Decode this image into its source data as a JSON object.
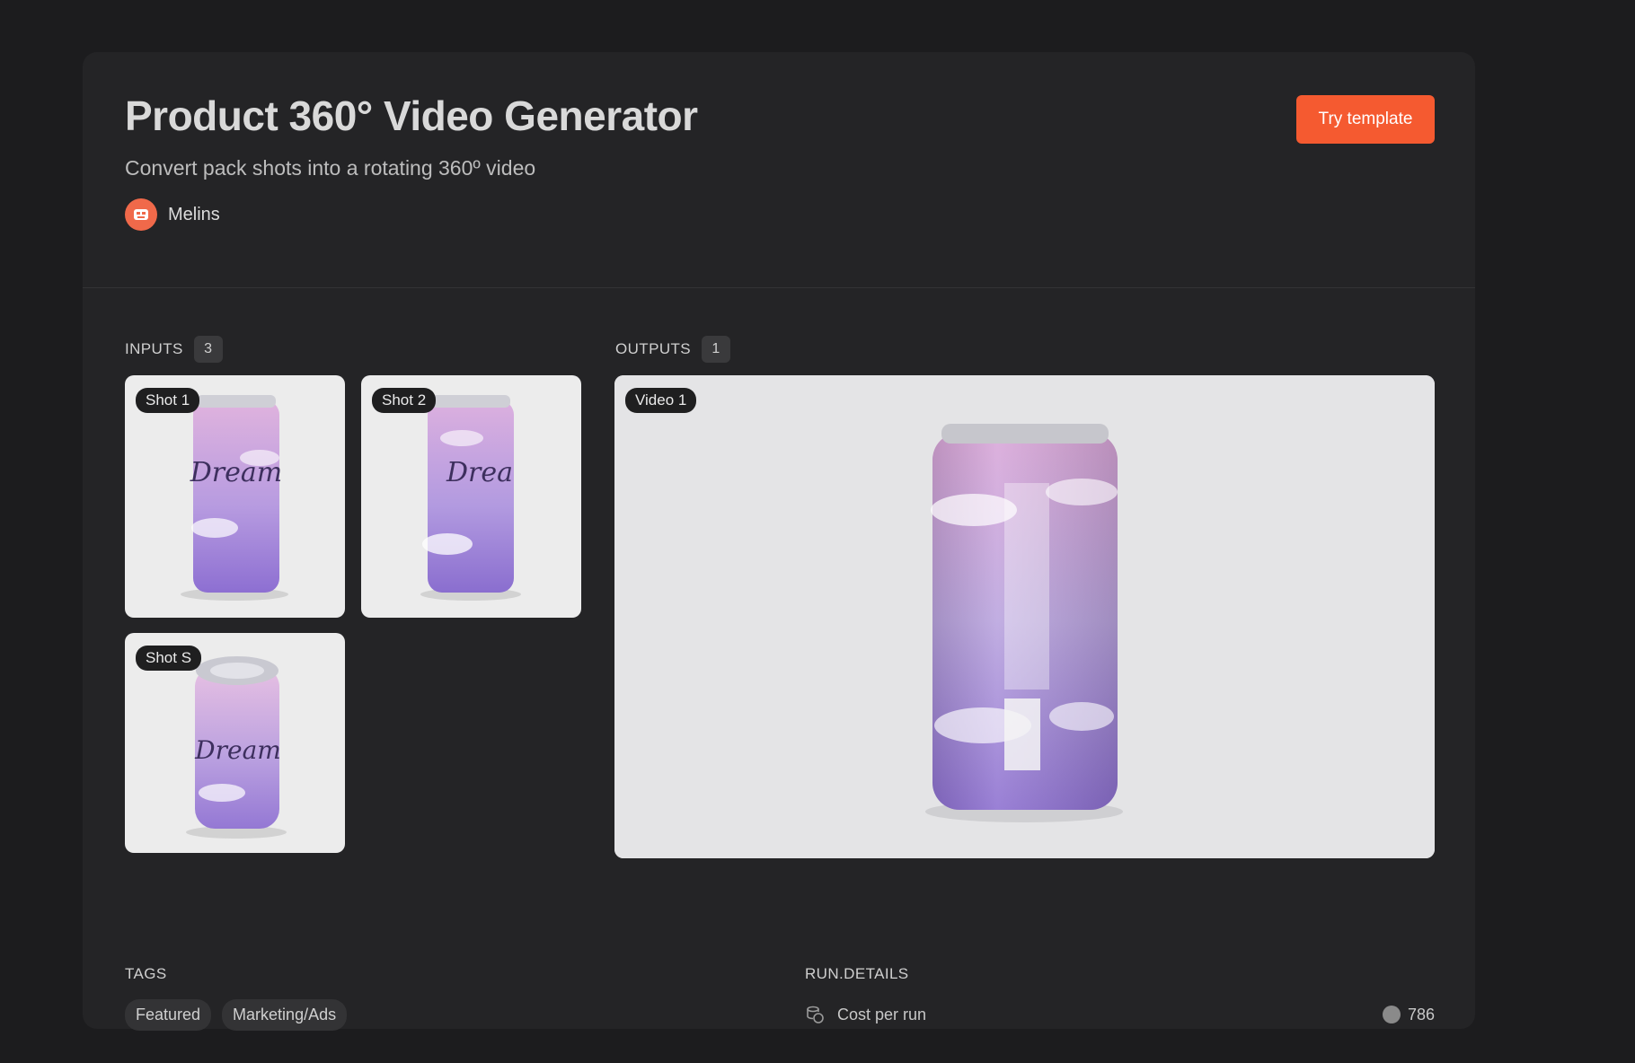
{
  "header": {
    "title": "Product 360° Video Generator",
    "subtitle": "Convert pack shots into a rotating 360º video",
    "author": "Melins",
    "cta_label": "Try template"
  },
  "inputs": {
    "label": "INPUTS",
    "count": "3",
    "items": [
      {
        "label": "Shot 1",
        "can_text": "Dream"
      },
      {
        "label": "Shot 2",
        "can_text": "Drea"
      },
      {
        "label": "Shot S",
        "can_text": "Dream"
      }
    ]
  },
  "outputs": {
    "label": "OUTPUTS",
    "count": "1",
    "items": [
      {
        "label": "Video 1"
      }
    ]
  },
  "tags": {
    "label": "TAGS",
    "items": [
      "Featured",
      "Marketing/Ads"
    ]
  },
  "run_details": {
    "label": "RUN.DETAILS",
    "cost_label": "Cost per run",
    "cost_value": "786"
  },
  "colors": {
    "accent": "#f55a30",
    "background": "#1c1c1e",
    "card": "#242426",
    "can_pink": "#d9a6d8",
    "can_purple": "#8c6fd0"
  },
  "icons": [
    "avatar-icon",
    "cost-icon",
    "coin-icon"
  ]
}
